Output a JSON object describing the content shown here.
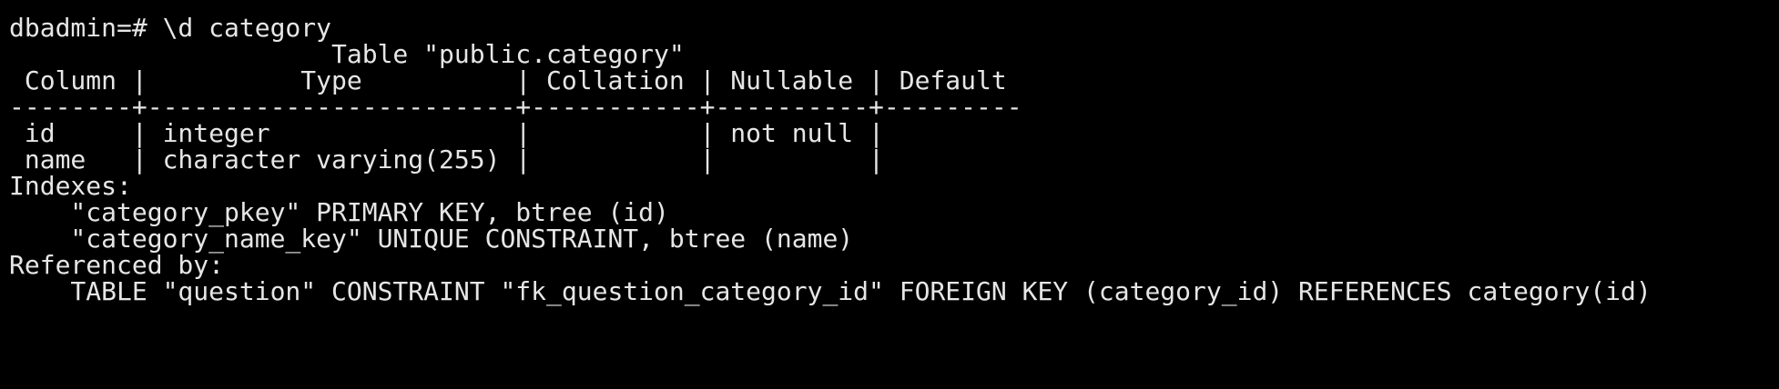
{
  "terminal": {
    "prompt": "dbadmin=# \\d category",
    "table_title": "                     Table \"public.category\"",
    "header_row": " Column |          Type          | Collation | Nullable | Default",
    "separator": "--------+------------------------+-----------+----------+---------",
    "rows": [
      " id     | integer                |           | not null |",
      " name   | character varying(255) |           |          |"
    ],
    "indexes_label": "Indexes:",
    "indexes": [
      "    \"category_pkey\" PRIMARY KEY, btree (id)",
      "    \"category_name_key\" UNIQUE CONSTRAINT, btree (name)"
    ],
    "referenced_label": "Referenced by:",
    "references": [
      "    TABLE \"question\" CONSTRAINT \"fk_question_category_id\" FOREIGN KEY (category_id) REFERENCES category(id)"
    ]
  }
}
